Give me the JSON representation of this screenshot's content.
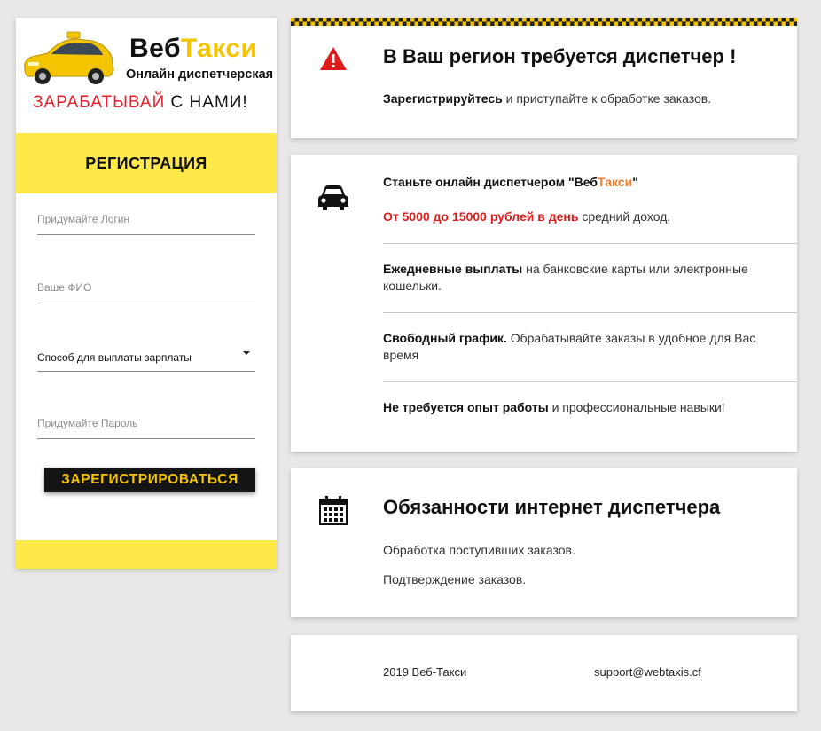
{
  "brand": {
    "name_part1": "Веб",
    "name_part2": "Такси",
    "subtitle": "Онлайн диспетчерская",
    "slogan_part1": "ЗАРАБАТЫВАЙ",
    "slogan_part2": "С НАМИ!"
  },
  "registration": {
    "title": "РЕГИСТРАЦИЯ",
    "login_placeholder": "Придумайте Логин",
    "name_placeholder": "Ваше ФИО",
    "payout_select": "Способ для выплаты зарплаты",
    "password_placeholder": "Придумайте Пароль",
    "submit_label": "ЗАРЕГИСТРИРОВАТЬСЯ"
  },
  "panel1": {
    "title": "В Ваш регион требуется диспетчер !",
    "text_bold": "Зарегистрируйтесь",
    "text": " и приступайте к обработке заказов."
  },
  "panel2": {
    "title_part1": "Станьте онлайн диспетчером \"Веб",
    "title_part2": "Такси",
    "title_part3": "\"",
    "income_bold": "От 5000 до 15000 рублей в день",
    "income_text": " средний доход.",
    "item1_bold": "Ежедневные выплаты",
    "item1_text": " на банковские карты или электронные кошельки.",
    "item2_bold": "Свободный график.",
    "item2_text": " Обрабатывайте заказы в удобное для Вас время",
    "item3_bold": "Не требуется опыт работы",
    "item3_text": " и профессиональные навыки!"
  },
  "panel3": {
    "title": "Обязанности интернет диспетчера",
    "line1": "Обработка поступивших заказов.",
    "line2": "Подтверждение заказов."
  },
  "footer": {
    "copyright": "2019 Веб-Такси",
    "email": "support@webtaxis.cf"
  },
  "icons": {
    "warning": "warning-icon",
    "car": "car-icon",
    "calendar": "calendar-icon"
  },
  "colors": {
    "yellow": "#fde94a",
    "accent_yellow": "#f5c400",
    "red": "#e01b1b",
    "orange": "#f07a2b"
  }
}
